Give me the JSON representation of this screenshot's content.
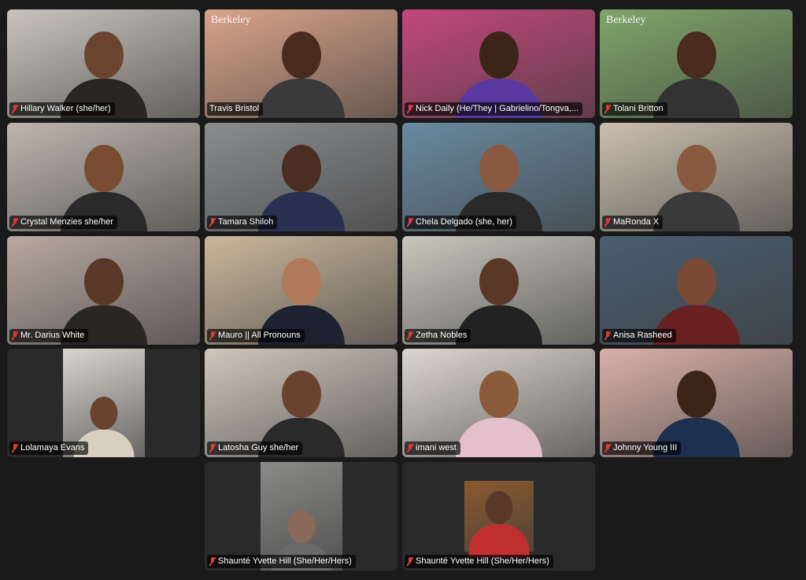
{
  "gallery": {
    "active_speaker_color": "#3fbf3f",
    "muted_icon_color": "#e03a3a",
    "tiles": [
      {
        "name": "Hillary Walker (she/her)",
        "muted": true,
        "bg": "#c9c4bd",
        "skin": "#6b4430",
        "shirt": "#2a2622"
      },
      {
        "name": "Travis Bristol",
        "muted": false,
        "active": true,
        "bg": "#d9a48a",
        "skin": "#4a2c1e",
        "shirt": "#3a3a3a",
        "overlay_text": "Berkeley"
      },
      {
        "name": "Nick Daily (He/They | Gabrielino/Tongva,...",
        "muted": true,
        "bg": "#c2487a",
        "skin": "#3d2418",
        "shirt": "#5a3aa0"
      },
      {
        "name": "Tolani Britton",
        "muted": true,
        "bg": "#7fa66a",
        "skin": "#4a2c1e",
        "shirt": "#333",
        "overlay_text": "Berkeley"
      },
      {
        "name": "Crystal Menzies she/her",
        "muted": true,
        "bg": "#bdb6ae",
        "skin": "#7a4c34",
        "shirt": "#2a2a2a"
      },
      {
        "name": "Tamara Shiloh",
        "muted": true,
        "bg": "#8a8c8e",
        "skin": "#4a2e22",
        "shirt": "#2a3050"
      },
      {
        "name": "Chela Delgado (she, her)",
        "muted": true,
        "bg": "#6a8aa0",
        "skin": "#8a5a40",
        "shirt": "#2a2a2a"
      },
      {
        "name": "MaRonda X",
        "muted": true,
        "bg": "#cbbfae",
        "skin": "#8a5a40",
        "shirt": "#3a3a3a"
      },
      {
        "name": "Mr. Darius White",
        "muted": true,
        "bg": "#b8a8a0",
        "skin": "#5a3828",
        "shirt": "#2a2622"
      },
      {
        "name": "Mauro || All Pronouns",
        "muted": true,
        "bg": "#c9b79c",
        "skin": "#b07a5a",
        "shirt": "#1e2230"
      },
      {
        "name": "Zetha Nobles",
        "muted": true,
        "bg": "#c8c6bc",
        "skin": "#5a3828",
        "shirt": "#222"
      },
      {
        "name": "Anisa Rasheed",
        "muted": true,
        "bg": "#4a5e70",
        "skin": "#7a4a34",
        "shirt": "#6a2020"
      },
      {
        "name": "Lolamaya Evans",
        "muted": true,
        "bg": "#d8d4ce",
        "skin": "#6a4230",
        "shirt": "#d8cfc0",
        "portrait": true
      },
      {
        "name": "Latosha Guy she/her",
        "muted": true,
        "bg": "#cfc6bc",
        "skin": "#6a4230",
        "shirt": "#2a2a2a"
      },
      {
        "name": "imani west",
        "muted": true,
        "bg": "#dcd6d0",
        "skin": "#8a5a3a",
        "shirt": "#e4c0cc"
      },
      {
        "name": "Johnny Young III",
        "muted": true,
        "bg": "#d8b0a8",
        "skin": "#3d2418",
        "shirt": "#1e3050"
      },
      {
        "name": "Shaunté Yvette Hill (She/Her/Hers)",
        "muted": true,
        "bg": "#8a8a88",
        "skin": "#8a6a5a",
        "shirt": "#6a6a6a",
        "portrait": true
      },
      {
        "name": "Shaunté Yvette Hill (She/Her/Hers)",
        "muted": true,
        "bg": "#8a5a30",
        "skin": "#5a3828",
        "shirt": "#c03030",
        "portrait": true,
        "small": true
      }
    ]
  }
}
